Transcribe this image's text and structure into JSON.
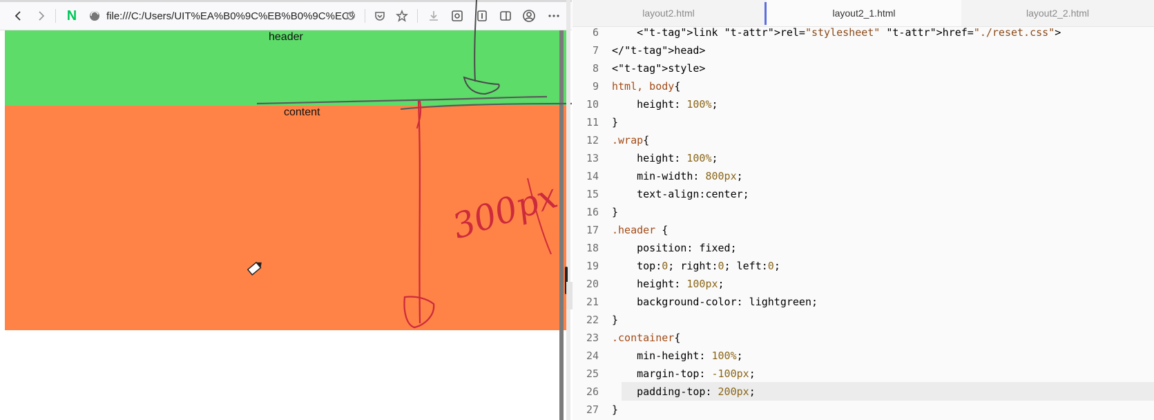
{
  "browser": {
    "url": "file:///C:/Users/UIT%EA%B0%9C%EB%B0%9C%EC%8",
    "logo": "N",
    "toolbar_icons": [
      "back-arrow-icon",
      "forward-arrow-icon",
      "naver-logo",
      "site-info-icon",
      "reload-icon",
      "pocket-icon",
      "bookmark-star-icon",
      "download-icon",
      "screenshot-icon",
      "reader-icon",
      "sidebar-icon",
      "account-icon",
      "menu-dots-icon"
    ],
    "page": {
      "header_text": "header",
      "content_text": "content"
    },
    "annotation": "300px"
  },
  "editor": {
    "tabs": [
      {
        "label": "layout2.html",
        "active": false
      },
      {
        "label": "layout2_1.html",
        "active": true
      },
      {
        "label": "layout2_2.html",
        "active": false
      }
    ],
    "lines": [
      {
        "num": "6",
        "text": "    <link rel=\"stylesheet\" href=\"./reset.css\">"
      },
      {
        "num": "7",
        "text": "</head>"
      },
      {
        "num": "8",
        "text": "<style>"
      },
      {
        "num": "9",
        "text": "html, body{"
      },
      {
        "num": "10",
        "text": "    height: 100%;"
      },
      {
        "num": "11",
        "text": "}"
      },
      {
        "num": "12",
        "text": ".wrap{"
      },
      {
        "num": "13",
        "text": "    height: 100%;"
      },
      {
        "num": "14",
        "text": "    min-width: 800px;"
      },
      {
        "num": "15",
        "text": "    text-align:center;"
      },
      {
        "num": "16",
        "text": "}"
      },
      {
        "num": "17",
        "text": ".header {"
      },
      {
        "num": "18",
        "text": "    position: fixed;"
      },
      {
        "num": "19",
        "text": "    top:0; right:0; left:0;"
      },
      {
        "num": "20",
        "text": "    height: 100px;"
      },
      {
        "num": "21",
        "text": "    background-color: lightgreen;"
      },
      {
        "num": "22",
        "text": "}"
      },
      {
        "num": "23",
        "text": ".container{"
      },
      {
        "num": "24",
        "text": "    min-height: 100%;"
      },
      {
        "num": "25",
        "text": "    margin-top: -100px;"
      },
      {
        "num": "26",
        "text": "    padding-top: 200px;"
      },
      {
        "num": "27",
        "text": "}"
      }
    ],
    "highlighted_line": "26"
  },
  "colors": {
    "header_bg": "#5ddc6a",
    "content_bg": "#ff8347",
    "pen": "#cc2b3c",
    "line_gray": "#5a5a5a"
  }
}
